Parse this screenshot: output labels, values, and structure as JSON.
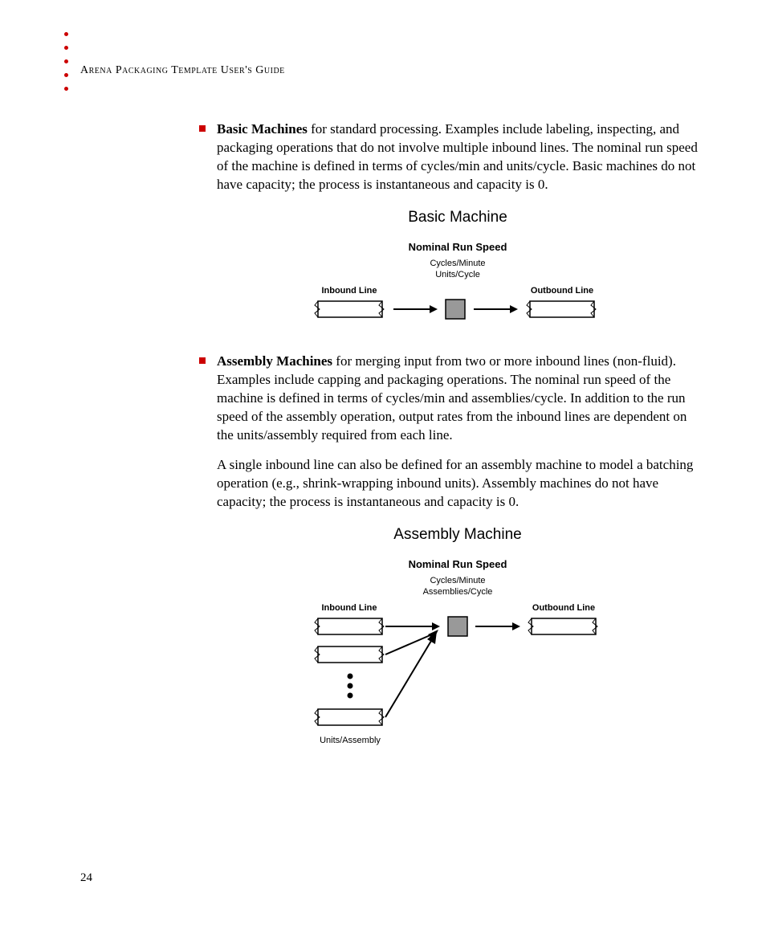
{
  "header": {
    "running_head": "Arena Packaging Template User's Guide"
  },
  "bullets": {
    "basic": {
      "title": "Basic Machines",
      "text": " for standard processing. Examples include labeling, inspecting, and packaging operations that do not involve multiple inbound lines. The nominal run speed of the machine is defined in terms of cycles/min and units/cycle. Basic machines do not have capacity; the process is instantaneous and capacity is 0."
    },
    "assembly": {
      "title": "Assembly Machines",
      "text": " for merging input from two or more inbound lines (non-fluid). Examples include capping and packaging operations. The nominal run speed of the machine is defined in terms of cycles/min and assemblies/cycle. In addition to the run speed of the assembly operation, output rates from the inbound lines are dependent on the units/assembly required from each line."
    }
  },
  "paragraphs": {
    "assembly_extra": "A single inbound line can also be defined for an assembly machine to model a batching operation (e.g., shrink-wrapping inbound units). Assembly machines do not have capacity; the process is instantaneous and capacity is 0."
  },
  "figures": {
    "basic": {
      "title": "Basic Machine",
      "subtitle": "Nominal Run Speed",
      "line1": "Cycles/Minute",
      "line2": "Units/Cycle",
      "inbound_label": "Inbound Line",
      "outbound_label": "Outbound Line"
    },
    "assembly": {
      "title": "Assembly Machine",
      "subtitle": "Nominal Run Speed",
      "line1": "Cycles/Minute",
      "line2": "Assemblies/Cycle",
      "inbound_label": "Inbound Line",
      "outbound_label": "Outbound Line",
      "units_label": "Units/Assembly"
    }
  },
  "page_number": "24"
}
